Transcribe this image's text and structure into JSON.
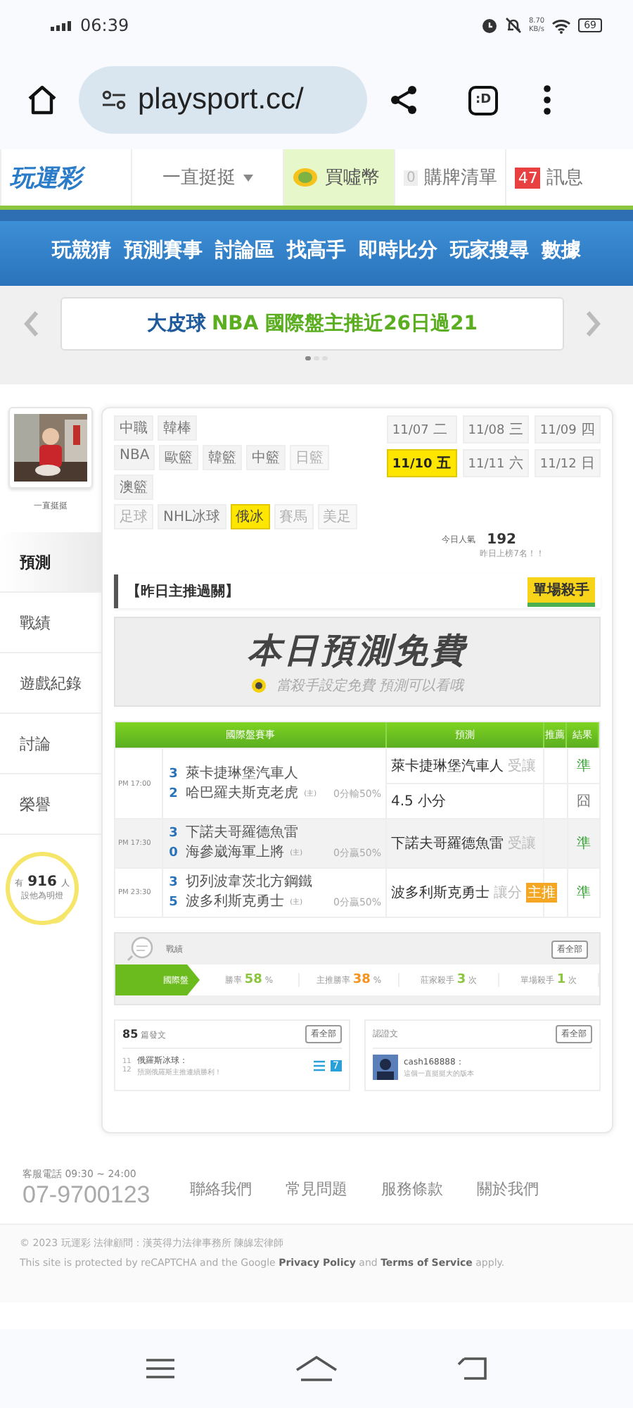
{
  "status_bar": {
    "time": "06:39",
    "net_speed": "8.70",
    "net_unit": "KB/s",
    "battery": "69"
  },
  "browser": {
    "url": "playsport.cc/",
    "tab_label": ":D"
  },
  "site_header": {
    "logo": "玩運彩",
    "user": "一直挺挺",
    "coin": "買噓幣",
    "cart_count": "0",
    "cart": "購牌清單",
    "message_count": "47",
    "messages": "訊息"
  },
  "nav": [
    "玩競猜",
    "預測賽事",
    "討論區",
    "找高手",
    "即時比分",
    "玩家搜尋",
    "數據"
  ],
  "ticker": {
    "prefix": "大皮球",
    "text": "NBA 國際盤主推近26日過21",
    "pages": [
      {
        "selected": true
      },
      {
        "selected": false
      },
      {
        "selected": false
      }
    ]
  },
  "profile": {
    "name": "一直挺挺"
  },
  "side_tabs": [
    {
      "label": "預測",
      "selected": true
    },
    {
      "label": "戰績",
      "selected": false
    },
    {
      "label": "遊戲紀錄",
      "selected": false
    },
    {
      "label": "討論",
      "selected": false
    },
    {
      "label": "榮譽",
      "selected": false
    }
  ],
  "fans": {
    "prefix": "有",
    "count": "916",
    "unit": "人",
    "caption": "設他為明燈"
  },
  "league_rows": [
    [
      {
        "label": "中職",
        "disabled": false,
        "selected": false
      },
      {
        "label": "韓棒",
        "disabled": false,
        "selected": false
      }
    ],
    [
      {
        "label": "NBA",
        "disabled": false,
        "selected": false
      },
      {
        "label": "歐籃",
        "disabled": false,
        "selected": false
      },
      {
        "label": "韓籃",
        "disabled": false,
        "selected": false
      },
      {
        "label": "中籃",
        "disabled": false,
        "selected": false
      },
      {
        "label": "日籃",
        "disabled": true,
        "selected": false
      }
    ],
    [
      {
        "label": "澳籃",
        "disabled": false,
        "selected": false
      }
    ],
    [
      {
        "label": "足球",
        "disabled": true,
        "selected": false
      },
      {
        "label": "NHL冰球",
        "disabled": false,
        "selected": false
      },
      {
        "label": "俄冰",
        "disabled": false,
        "selected": true
      },
      {
        "label": "賽馬",
        "disabled": true,
        "selected": false
      },
      {
        "label": "美足",
        "disabled": true,
        "selected": false
      }
    ]
  ],
  "dates": [
    {
      "date": "11/07",
      "day": "二",
      "selected": false
    },
    {
      "date": "11/08",
      "day": "三",
      "selected": false
    },
    {
      "date": "11/09",
      "day": "四",
      "selected": false
    },
    {
      "date": "11/10",
      "day": "五",
      "selected": true
    },
    {
      "date": "11/11",
      "day": "六",
      "selected": false
    },
    {
      "date": "11/12",
      "day": "日",
      "selected": false
    }
  ],
  "popularity": {
    "label": "今日人氣",
    "value": "192",
    "note": "昨日上榜7名！！"
  },
  "highlight": {
    "title": "【昨日主推過關】",
    "badge": "單場殺手"
  },
  "free_banner": {
    "title": "本日預測免費",
    "subtitle": "當殺手設定免費 預測可以看哦"
  },
  "table": {
    "columns": [
      "國際盤賽事",
      "預測",
      "推薦",
      "結果"
    ],
    "rows": [
      {
        "time": "PM 17:00",
        "shaded": false,
        "away_score": "3",
        "away": "萊卡捷琳堡汽車人",
        "home_score": "2",
        "home": "哈巴羅夫斯克老虎",
        "home_mark": "(主)",
        "handicap": "0分輸50%",
        "picks": [
          {
            "pick": "萊卡捷琳堡汽車人",
            "type": "受讓",
            "result": "準",
            "hit": true
          },
          {
            "pick": "4.5 小分",
            "result": "囧",
            "hit": false
          }
        ]
      },
      {
        "time": "PM 17:30",
        "shaded": true,
        "away_score": "3",
        "away": "下諾夫哥羅德魚雷",
        "home_score": "0",
        "home": "海參崴海軍上將",
        "home_mark": "(主)",
        "handicap": "0分贏50%",
        "picks": [
          {
            "pick": "下諾夫哥羅德魚雷",
            "type": "受讓",
            "result": "準",
            "hit": true
          }
        ]
      },
      {
        "time": "PM 23:30",
        "shaded": false,
        "away_score": "3",
        "away": "切列波韋茨北方鋼鐵",
        "home_score": "5",
        "home": "波多利斯克勇士",
        "home_mark": "(主)",
        "handicap": "0分贏50%",
        "picks": [
          {
            "pick": "波多利斯克勇士",
            "type": "讓分",
            "badge": "主推",
            "result": "準",
            "hit": true
          }
        ]
      }
    ]
  },
  "stats": {
    "title": "戰績",
    "more": "看全部",
    "tag": "國際盤",
    "items": [
      {
        "label": "勝率",
        "value": "58",
        "unit": "%",
        "color": "#8cc63f"
      },
      {
        "label": "主推勝率",
        "value": "38",
        "unit": "%",
        "color": "#f7931e"
      },
      {
        "label": "莊家殺手",
        "value": "3",
        "unit": "次",
        "color": "#8cc63f"
      },
      {
        "label": "單場殺手",
        "value": "1",
        "unit": "次",
        "color": "#8cc63f"
      }
    ]
  },
  "posts": {
    "count": "85",
    "label": "篇發文",
    "more": "看全部",
    "date": "11",
    "month": "12",
    "title": "俄羅斯冰球：",
    "text": "預測俄羅斯主推連續勝利！",
    "badge": "7"
  },
  "certified": {
    "title": "認證文",
    "more": "看全部",
    "user": "cash168888：",
    "text": "這個一直挺挺大的版本"
  },
  "footer": {
    "phone_label": "客服電話 09:30 ~ 24:00",
    "phone": "07-9700123",
    "links": [
      "聯絡我們",
      "常見問題",
      "服務條款",
      "關於我們"
    ],
    "copyright": "© 2023 玩運彩 法律顧問：漢英得力法律事務所 陳皞宏律師",
    "recaptcha": "This site is protected by reCAPTCHA and the Google **Privacy Policy** and **Terms of Service** apply."
  }
}
